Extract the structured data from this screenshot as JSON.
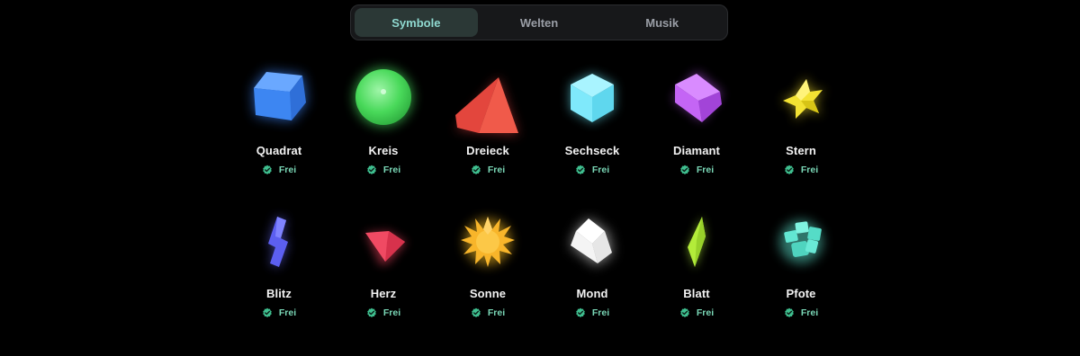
{
  "tabs": [
    {
      "label": "Symbole",
      "active": true
    },
    {
      "label": "Welten",
      "active": false
    },
    {
      "label": "Musik",
      "active": false
    }
  ],
  "items": [
    {
      "name": "Quadrat",
      "status": "Frei",
      "icon": "cube-icon",
      "color": "#3b82f6"
    },
    {
      "name": "Kreis",
      "status": "Frei",
      "icon": "sphere-icon",
      "color": "#4ade60"
    },
    {
      "name": "Dreieck",
      "status": "Frei",
      "icon": "pyramid-icon",
      "color": "#ef4444"
    },
    {
      "name": "Sechseck",
      "status": "Frei",
      "icon": "hexagon-icon",
      "color": "#67e8f9"
    },
    {
      "name": "Diamant",
      "status": "Frei",
      "icon": "diamond-icon",
      "color": "#c056f5"
    },
    {
      "name": "Stern",
      "status": "Frei",
      "icon": "star-icon",
      "color": "#f5e02a"
    },
    {
      "name": "Blitz",
      "status": "Frei",
      "icon": "lightning-icon",
      "color": "#6366f1"
    },
    {
      "name": "Herz",
      "status": "Frei",
      "icon": "heart-icon",
      "color": "#f0435e"
    },
    {
      "name": "Sonne",
      "status": "Frei",
      "icon": "sun-icon",
      "color": "#fbbf24"
    },
    {
      "name": "Mond",
      "status": "Frei",
      "icon": "moon-icon",
      "color": "#ffffff"
    },
    {
      "name": "Blatt",
      "status": "Frei",
      "icon": "leaf-icon",
      "color": "#b6f23a"
    },
    {
      "name": "Pfote",
      "status": "Frei",
      "icon": "paw-icon",
      "color": "#5eead4"
    }
  ],
  "colors": {
    "background": "#000000",
    "tab_active_bg": "#2b3836",
    "tab_active_text": "#8fd9d0",
    "tab_inactive_text": "#9a9ea6",
    "status_green": "#7ad7b6"
  }
}
